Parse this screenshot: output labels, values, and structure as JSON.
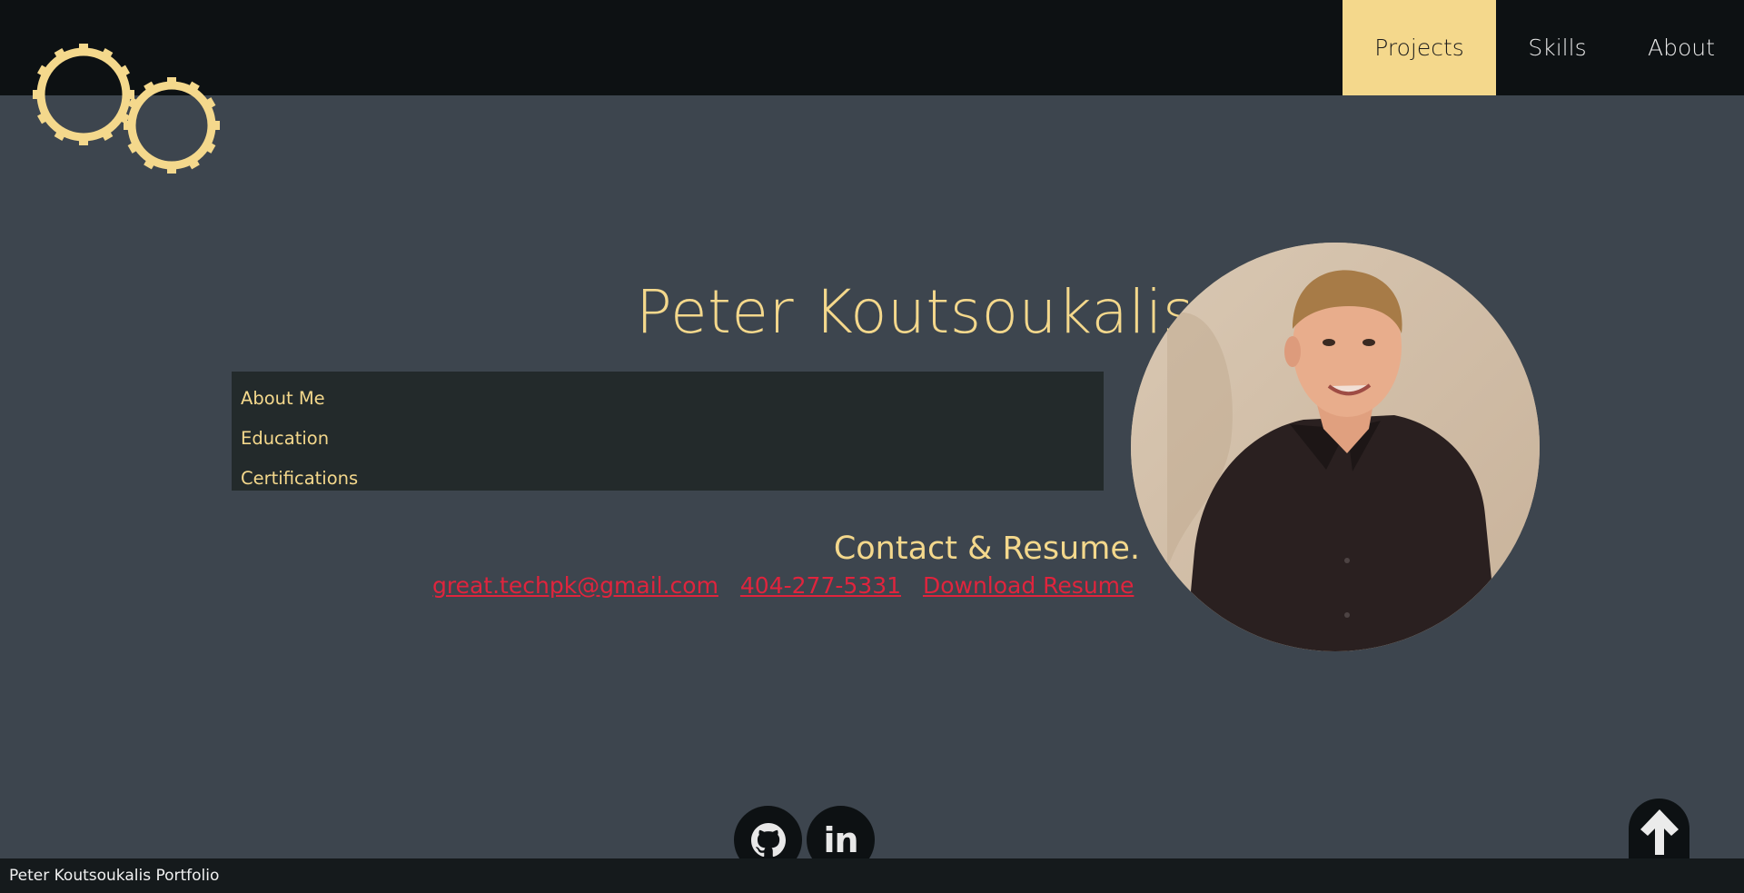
{
  "nav": {
    "items": [
      {
        "label": "Projects",
        "active": true
      },
      {
        "label": "Skills",
        "active": false
      },
      {
        "label": "About",
        "active": false
      }
    ]
  },
  "logo": {
    "icon": "gears-icon",
    "color": "#f4d88c"
  },
  "hero": {
    "name": "Peter Koutsoukalis."
  },
  "menu": {
    "items": [
      {
        "label": "About Me"
      },
      {
        "label": "Education"
      },
      {
        "label": "Certifications"
      }
    ]
  },
  "contact": {
    "title": "Contact & Resume.",
    "email": "great.techpk@gmail.com",
    "phone": "404-277-5331",
    "resume": "Download Resume"
  },
  "social": {
    "github_icon": "github-icon",
    "linkedin_icon": "linkedin-icon",
    "linkedin_text": "in"
  },
  "footer": {
    "text": "Peter Koutsoukalis Portfolio"
  },
  "colors": {
    "accent": "#f4d88c",
    "link": "#e0243d",
    "background": "#3d454e",
    "topbar": "#0d1113"
  }
}
